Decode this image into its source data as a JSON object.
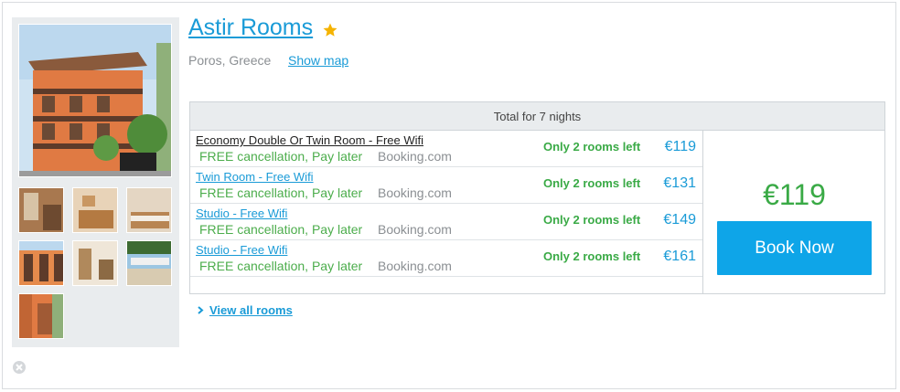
{
  "hotel": {
    "name": "Astir Rooms",
    "location": "Poros, Greece",
    "show_map": "Show map"
  },
  "rooms_table": {
    "header": "Total for 7 nights",
    "rows": [
      {
        "name": "Economy Double Or Twin Room - Free Wifi",
        "cancellation": "FREE cancellation, Pay later",
        "provider": "Booking.com",
        "availability": "Only 2 rooms left",
        "price": "€119"
      },
      {
        "name": "Twin Room - Free Wifi",
        "cancellation": "FREE cancellation, Pay later",
        "provider": "Booking.com",
        "availability": "Only 2 rooms left",
        "price": "€131"
      },
      {
        "name": "Studio - Free Wifi",
        "cancellation": "FREE cancellation, Pay later",
        "provider": "Booking.com",
        "availability": "Only 2 rooms left",
        "price": "€149"
      },
      {
        "name": "Studio - Free Wifi",
        "cancellation": "FREE cancellation, Pay later",
        "provider": "Booking.com",
        "availability": "Only 2 rooms left",
        "price": "€161"
      }
    ],
    "best_price": "€119",
    "book_now": "Book Now"
  },
  "view_all": "View all rooms",
  "colors": {
    "link_blue": "#1a9bd7",
    "green": "#3aaa46",
    "button_blue": "#0ea5e8",
    "star": "#f5b301"
  },
  "icons": [
    "star-icon",
    "chevron-right-icon",
    "close-icon"
  ]
}
